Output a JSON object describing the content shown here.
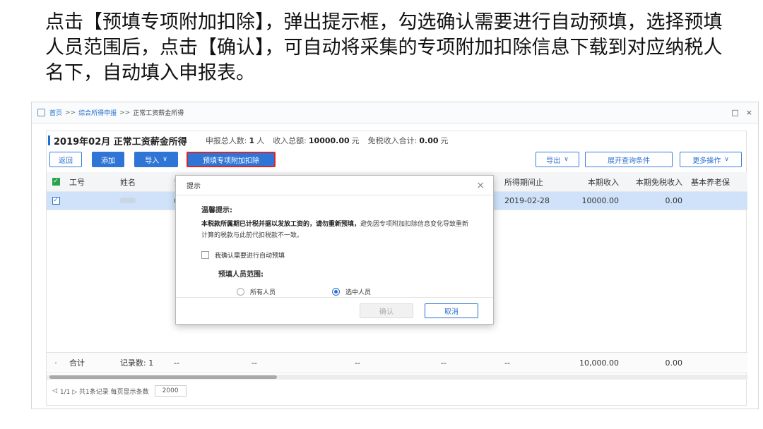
{
  "caption": "点击【预填专项附加扣除】，弹出提示框，勾选确认需要进行自动预填，选择预填人员范围后，点击【确认】，可自动将采集的专项附加扣除信息下载到对应纳税人名下，自动填入申报表。",
  "breadcrumb": {
    "home": "首页",
    "sep": ">>",
    "level2": "综合所得申报",
    "level3": "正常工资薪金所得"
  },
  "window_controls": {
    "restore": "□",
    "close": "×"
  },
  "header": {
    "title": "2019年02月 正常工资薪金所得",
    "count_label": "申报总人数:",
    "count_value": "1",
    "count_unit": "人",
    "income_label": "收入总额:",
    "income_value": "10000.00",
    "income_unit": "元",
    "exempt_label": "免税收入合计:",
    "exempt_value": "0.00",
    "exempt_unit": "元"
  },
  "toolbar": {
    "back": "返回",
    "add": "添加",
    "import": "导入",
    "prefill": "预填专项附加扣除",
    "export": "导出",
    "expand": "展开查询条件",
    "more": "更多操作",
    "caret": "∨"
  },
  "table": {
    "headers": [
      "工号",
      "姓名",
      "证",
      "",
      "",
      "",
      "所得期间止",
      "本期收入",
      "本期免税收入",
      "基本养老保"
    ],
    "row": {
      "id_partial": "中",
      "period_end": "2019-02-28",
      "income": "10000.00",
      "exempt": "0.00"
    },
    "summary": {
      "label": "合计",
      "record_label": "记录数: 1",
      "dash": "--",
      "income": "10,000.00",
      "exempt": "0.00"
    }
  },
  "pager": {
    "text": "1/1 ▷ 共1条记录  每页显示条数",
    "page_size": "2000"
  },
  "dialog": {
    "title": "提示",
    "close": "×",
    "tip_title": "温馨提示:",
    "tip_bold": "本税款所属期已计税并据以发放工资的，请勿重新预填，",
    "tip_rest": "避免因专项附加扣除信息变化导致重新计算的税款与此前代扣税款不一致。",
    "confirm_label": "我确认需要进行自动预填",
    "range_label": "预填人员范围:",
    "options": [
      "所有人员",
      "选中人员"
    ],
    "selected_option": "选中人员",
    "ok": "确认",
    "cancel": "取消"
  },
  "colors": {
    "accent": "#2f75d6",
    "highlight_border": "#e02424",
    "selected_row": "#cfe2fa",
    "check_green": "#2aa34b"
  }
}
